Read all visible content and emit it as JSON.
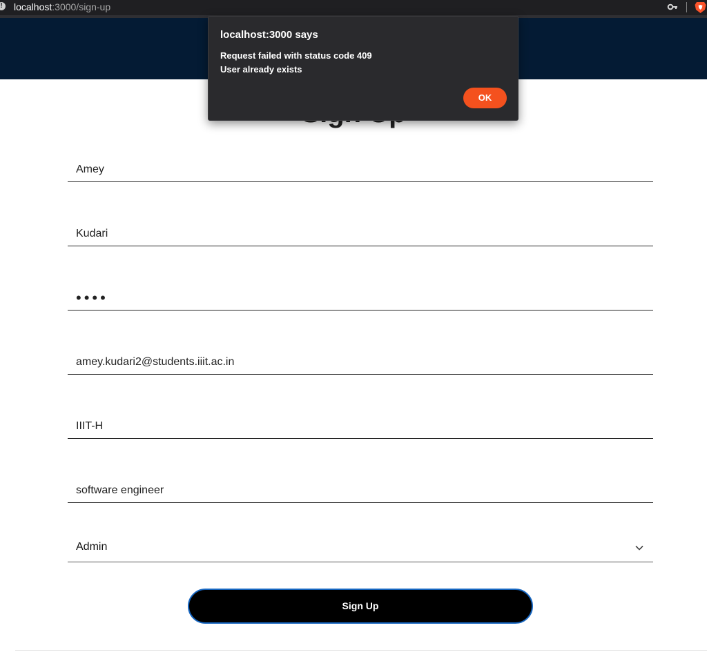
{
  "browser": {
    "url_host": "localhost",
    "url_path": ":3000/sign-up",
    "info_icon": "info-icon",
    "key_icon": "key-icon",
    "brave_icon": "brave-lion-icon"
  },
  "page": {
    "title": "Sign Up"
  },
  "form": {
    "first_name": "Amey",
    "last_name": "Kudari",
    "password_mask": "••••",
    "email": "amey.kudari2@students.iiit.ac.in",
    "institute": "IIIT-H",
    "role": "software engineer",
    "user_type": "Admin",
    "dropdown_icon": "chevron-down-icon",
    "submit_label": "Sign Up"
  },
  "alert": {
    "title": "localhost:3000 says",
    "message_line1": "Request failed with status code 409",
    "message_line2": "User already exists",
    "ok_label": "OK"
  },
  "colors": {
    "header": "#041b34",
    "ok_button": "#f4511e",
    "submit_border": "#1565c0"
  }
}
